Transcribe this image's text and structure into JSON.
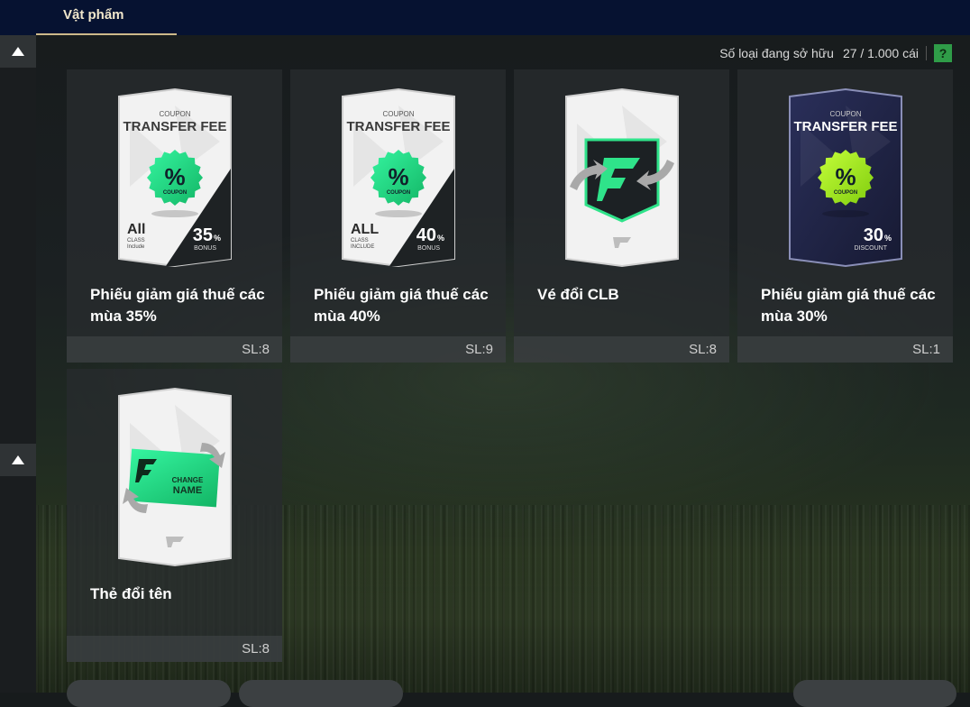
{
  "tabs": [
    {
      "label": "Vật phẩm",
      "active": true
    }
  ],
  "owned": {
    "label": "Số loại đang sở hữu",
    "count": "27 / 1.000 cái",
    "help": "?"
  },
  "items": [
    {
      "name": "Phiếu giảm giá thuế các mùa 35%",
      "qty": "SL:8",
      "art": {
        "kind": "coupon",
        "theme": "white",
        "top": "COUPON",
        "title": "TRANSFER FEE",
        "badge": "%",
        "badge_sub": "COUPON",
        "left_big": "All",
        "left_small1": "CLASS",
        "left_small2": "Include",
        "pct": "35",
        "pct_unit": "%",
        "pct_label": "BONUS"
      }
    },
    {
      "name": "Phiếu giảm giá thuế các mùa 40%",
      "qty": "SL:9",
      "art": {
        "kind": "coupon",
        "theme": "white",
        "top": "COUPON",
        "title": "TRANSFER FEE",
        "badge": "%",
        "badge_sub": "COUPON",
        "left_big": "ALL",
        "left_small1": "CLASS",
        "left_small2": "INCLUDE",
        "pct": "40",
        "pct_unit": "%",
        "pct_label": "BONUS"
      }
    },
    {
      "name": "Vé đổi CLB",
      "qty": "SL:8",
      "art": {
        "kind": "club"
      }
    },
    {
      "name": "Phiếu giảm giá thuế các mùa 30%",
      "qty": "SL:1",
      "art": {
        "kind": "coupon",
        "theme": "dark",
        "top": "COUPON",
        "title": "TRANSFER FEE",
        "badge": "%",
        "badge_sub": "COUPON",
        "pct": "30",
        "pct_unit": "%",
        "pct_label": "DISCOUNT"
      }
    },
    {
      "name": "Thẻ đổi tên",
      "qty": "SL:8",
      "art": {
        "kind": "rename",
        "line1": "CHANGE",
        "line2": "NAME"
      }
    }
  ],
  "colors": {
    "accent_green": "#2fe38a",
    "lime": "#9be01b",
    "topbar": "#061231",
    "tab_underline": "#cdb98a"
  }
}
